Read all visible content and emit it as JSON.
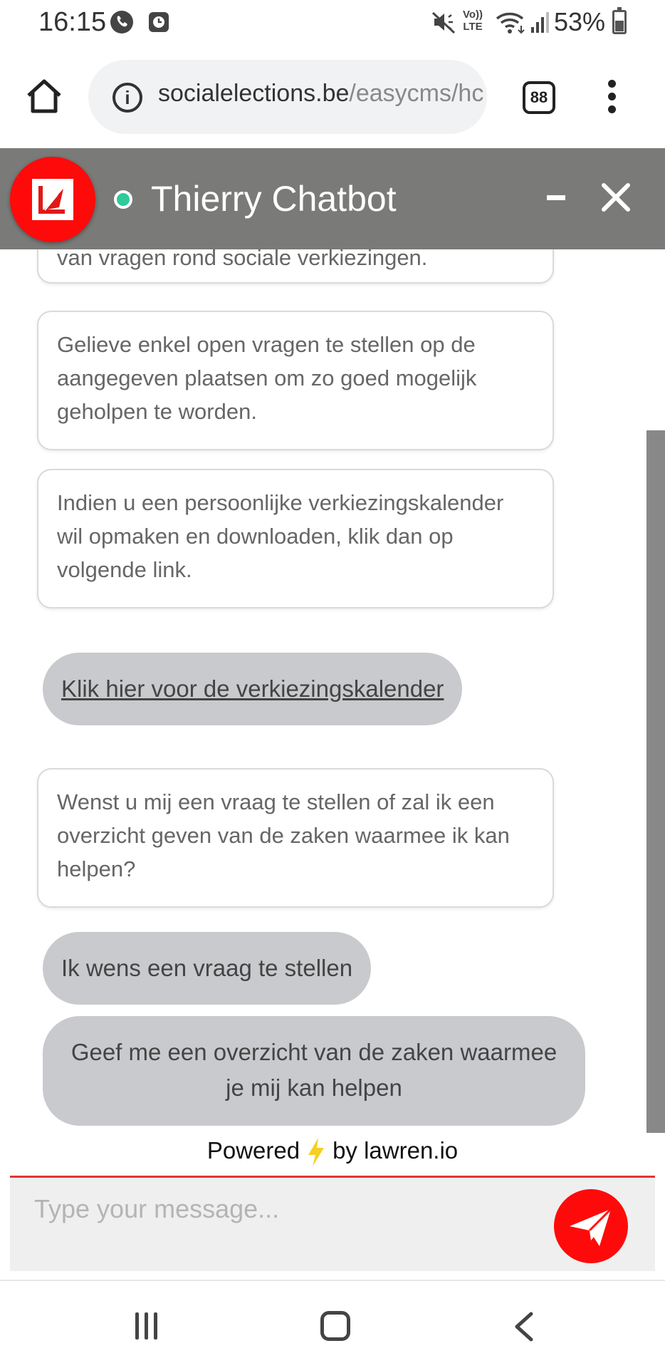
{
  "status_bar": {
    "time": "16:15",
    "battery": "53%",
    "icons": [
      "phone-icon",
      "clock-icon",
      "mute-icon",
      "volte-icon",
      "wifi-icon",
      "signal-icon",
      "battery-icon"
    ]
  },
  "browser": {
    "url_domain": "socialelections.be",
    "url_path": "/easycms/hc",
    "tab_count": "88"
  },
  "chat": {
    "title": "Thierry Chatbot",
    "online_color": "#2fc99a",
    "header_color": "#7a7a78",
    "accent_color": "#ff0a0a",
    "messages": [
      {
        "text": "van vragen rond sociale verkiezingen."
      },
      {
        "text": "Gelieve enkel open vragen te stellen op de aangegeven plaatsen om zo goed mogelijk geholpen te worden."
      },
      {
        "text": "Indien u een persoonlijke verkiezingskalender wil opmaken en downloaden, klik dan op volgende link."
      },
      {
        "text": "Wenst u mij een vraag te stellen of zal ik een overzicht geven van de zaken waarmee ik kan helpen?"
      }
    ],
    "link_button": "Klik hier voor de verkiezingskalender",
    "option_question": "Ik wens een vraag te stellen",
    "option_overview": "Geef me een overzicht van de zaken waarmee je mij kan helpen"
  },
  "powered": {
    "prefix": "Powered",
    "suffix": "by lawren.io"
  },
  "input": {
    "placeholder": "Type your message...",
    "value": ""
  }
}
